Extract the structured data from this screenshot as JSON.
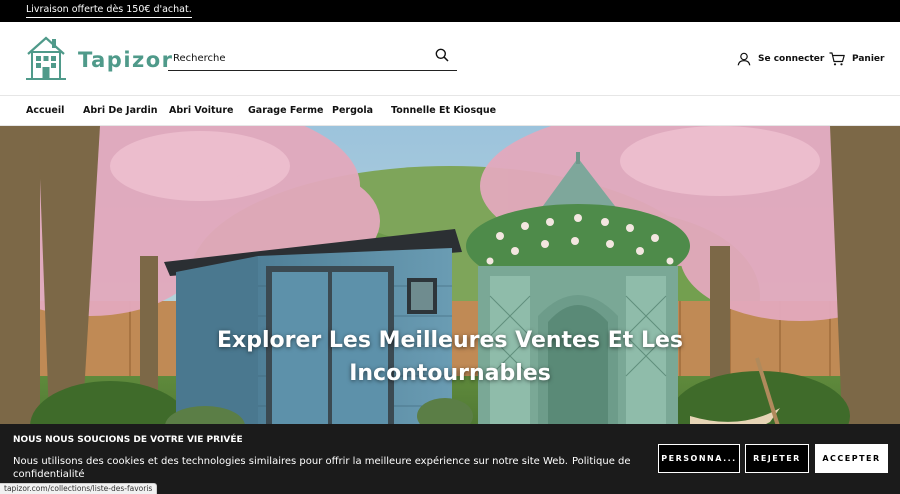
{
  "announcement": {
    "text": "Livraison offerte dès 150€ d'achat."
  },
  "header": {
    "logo_text": "Tapizor",
    "search": {
      "placeholder": "Recherche",
      "icon": "search-icon"
    },
    "account": {
      "label": "Se connecter",
      "icon": "user-icon"
    },
    "cart": {
      "label": "Panier",
      "icon": "cart-icon"
    }
  },
  "nav": {
    "items": [
      {
        "label": "Accueil"
      },
      {
        "label": "Abri De Jardin"
      },
      {
        "label": "Abri Voiture"
      },
      {
        "label": "Garage Ferme"
      },
      {
        "label": "Pergola"
      },
      {
        "label": "Tonnelle Et Kiosque"
      }
    ]
  },
  "hero": {
    "title": "Explorer Les Meilleures Ventes Et Les Incontournables"
  },
  "cookie": {
    "title": "NOUS NOUS SOUCIONS DE VOTRE VIE PRIVÉE",
    "text": "Nous utilisons des cookies et des technologies similaires pour offrir la meilleure expérience sur notre site Web.",
    "link": "Politique de confidentialité",
    "buttons": {
      "customize": "PERSONNA...",
      "reject": "REJETER",
      "accept": "ACCEPTER"
    }
  },
  "status_bar": {
    "url": "tapizor.com/collections/liste-des-favoris"
  },
  "colors": {
    "brand": "#4f9a8a",
    "banner_bg": "#1b1b1b",
    "announce_bg": "#000000"
  }
}
